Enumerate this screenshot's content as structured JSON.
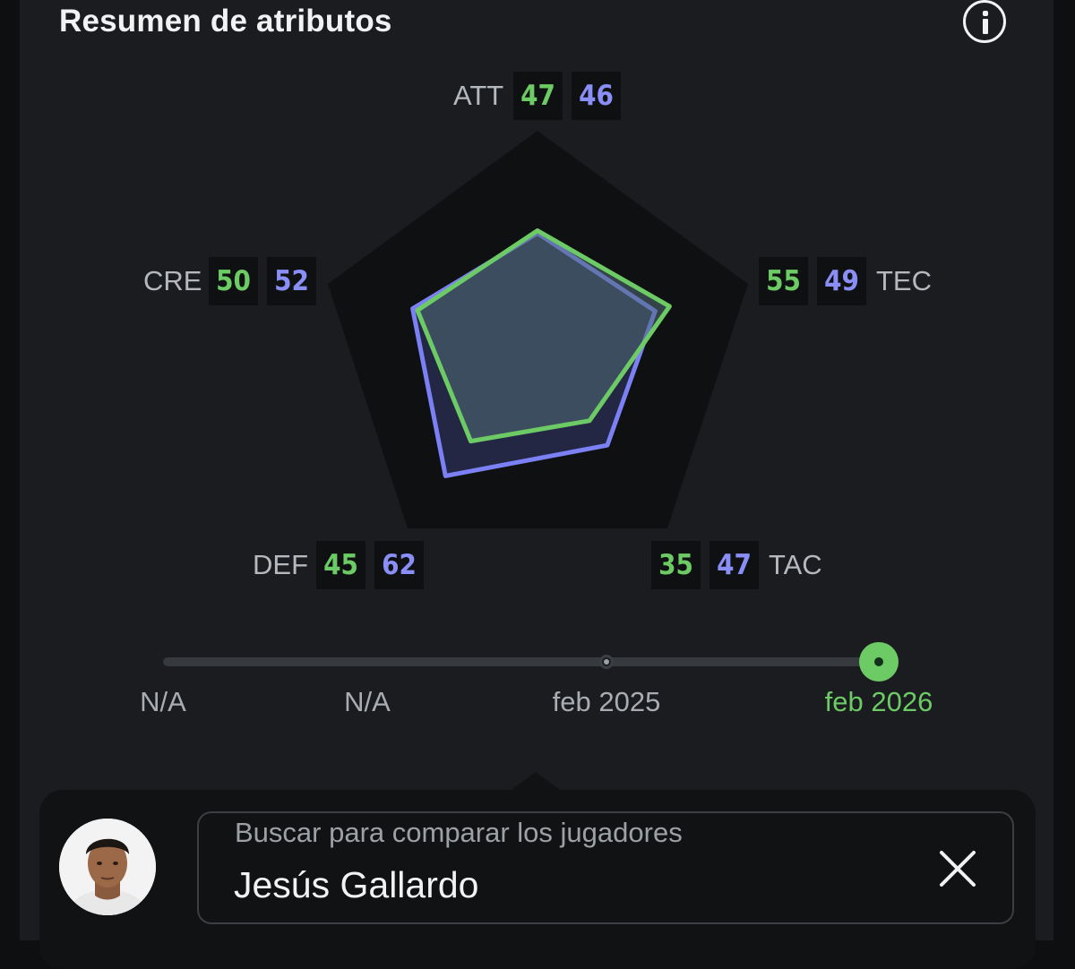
{
  "header": {
    "title": "Resumen de atributos",
    "info_icon": "info-icon"
  },
  "colors": {
    "player_a": "#6ccb64",
    "player_b": "#8a8ff8"
  },
  "attributes": [
    {
      "key": "att",
      "label": "ATT",
      "value_green": "47",
      "value_blue": "46"
    },
    {
      "key": "tec",
      "label": "TEC",
      "value_green": "55",
      "value_blue": "49"
    },
    {
      "key": "tac",
      "label": "TAC",
      "value_green": "35",
      "value_blue": "47"
    },
    {
      "key": "def",
      "label": "DEF",
      "value_green": "45",
      "value_blue": "62"
    },
    {
      "key": "cre",
      "label": "CRE",
      "value_green": "50",
      "value_blue": "52"
    }
  ],
  "chart_data": {
    "type": "radar",
    "axes": [
      "ATT",
      "TEC",
      "TAC",
      "DEF",
      "CRE"
    ],
    "series": [
      {
        "values": [
          47,
          55,
          35,
          45,
          50
        ],
        "color": "#6ccb64"
      },
      {
        "values": [
          46,
          49,
          47,
          62,
          52
        ],
        "color": "#8a8ff8"
      }
    ],
    "range": [
      0,
      100
    ]
  },
  "timeline": {
    "labels": [
      "N/A",
      "N/A",
      "feb 2025",
      "feb 2026"
    ],
    "selected": "feb 2026"
  },
  "compare": {
    "search_label": "Buscar para comparar los jugadores",
    "player_name": "Jesús Gallardo",
    "clear_icon": "close-icon"
  }
}
